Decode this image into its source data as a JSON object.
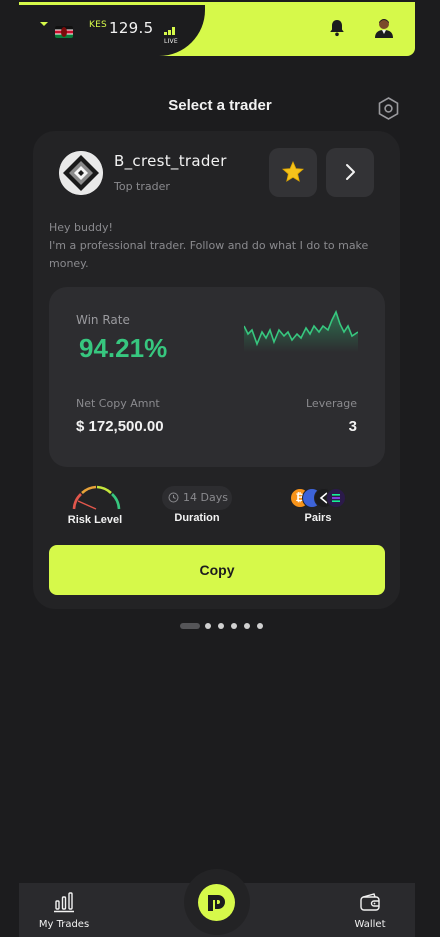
{
  "header": {
    "currency_code": "KES",
    "balance": "129.5",
    "live_label": "LIVE",
    "flag": "kenya-flag",
    "accent": "#d6f94a"
  },
  "page": {
    "title": "Select a trader"
  },
  "trader": {
    "name": "B_crest_trader",
    "subtitle": "Top trader",
    "bio_line1": "Hey buddy!",
    "bio_line2": "I'm a professional trader. Follow and do what I do to make money."
  },
  "stats": {
    "win_rate_label": "Win Rate",
    "win_rate_value": "94.21%",
    "win_rate_color": "#37c77f",
    "net_copy_label": "Net Copy Amnt",
    "net_copy_value": "$ 172,500.00",
    "leverage_label": "Leverage",
    "leverage_value": "3"
  },
  "meta": {
    "risk_label": "Risk Level",
    "duration_value": "14 Days",
    "duration_label": "Duration",
    "pairs_label": "Pairs",
    "pairs_icons": [
      "bitcoin-coin",
      "moon-coin",
      "stellar-coin",
      "solana-coin"
    ]
  },
  "actions": {
    "copy_label": "Copy"
  },
  "pager": {
    "total": 6,
    "active_index": 0
  },
  "nav": {
    "my_trades_label": "My Trades",
    "wallet_label": "Wallet"
  }
}
